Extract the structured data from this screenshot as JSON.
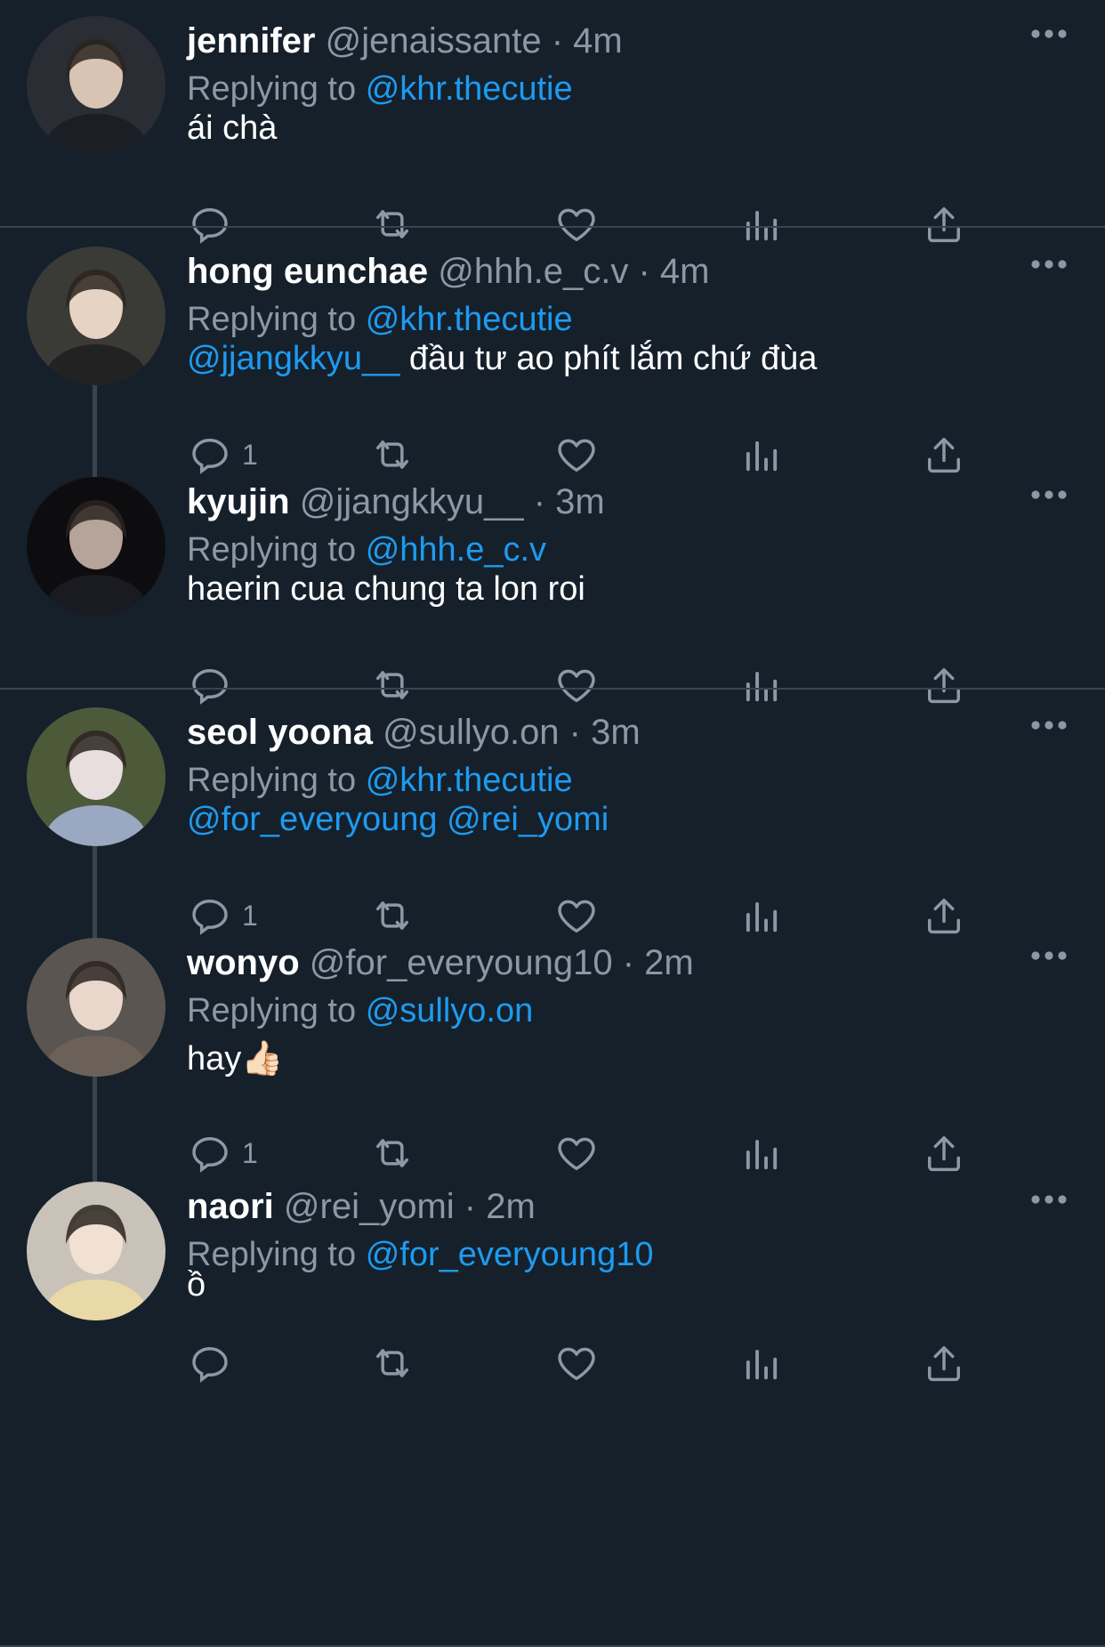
{
  "colors": {
    "background": "#15202b",
    "name": "#ffffff",
    "muted": "#8b98a5",
    "link": "#1d9bf0",
    "divider": "#38444d"
  },
  "reply_prefix": "Replying to",
  "tweets": [
    {
      "name": "jennifer",
      "handle": "@jenaissante",
      "time": "4m",
      "replying_to": "@khr.thecutie",
      "text_mention": "",
      "text": "ái chà",
      "reply_count": ""
    },
    {
      "name": "hong eunchae",
      "handle": "@hhh.e_c.v",
      "time": "4m",
      "replying_to": "@khr.thecutie",
      "text_mention": "@jjangkkyu__",
      "text": " đầu tư ao phít lắm chứ đùa",
      "reply_count": "1"
    },
    {
      "name": "kyujin",
      "handle": "@jjangkkyu__",
      "time": "3m",
      "replying_to": "@hhh.e_c.v",
      "text_mention": "",
      "text": "haerin cua chung ta lon roi",
      "reply_count": ""
    },
    {
      "name": "seol yoona",
      "handle": "@sullyo.on",
      "time": "3m",
      "replying_to": "@khr.thecutie",
      "text_mention": "@for_everyoung @rei_yomi",
      "text": "",
      "reply_count": "1"
    },
    {
      "name": "wonyo",
      "handle": "@for_everyoung10",
      "time": "2m",
      "replying_to": "@sullyo.on",
      "text_mention": "",
      "text": "hay👍🏻",
      "reply_count": "1"
    },
    {
      "name": "naori",
      "handle": "@rei_yomi",
      "time": "2m",
      "replying_to": "@for_everyoung10",
      "text_mention": "",
      "text": "ồ",
      "reply_count": ""
    }
  ]
}
